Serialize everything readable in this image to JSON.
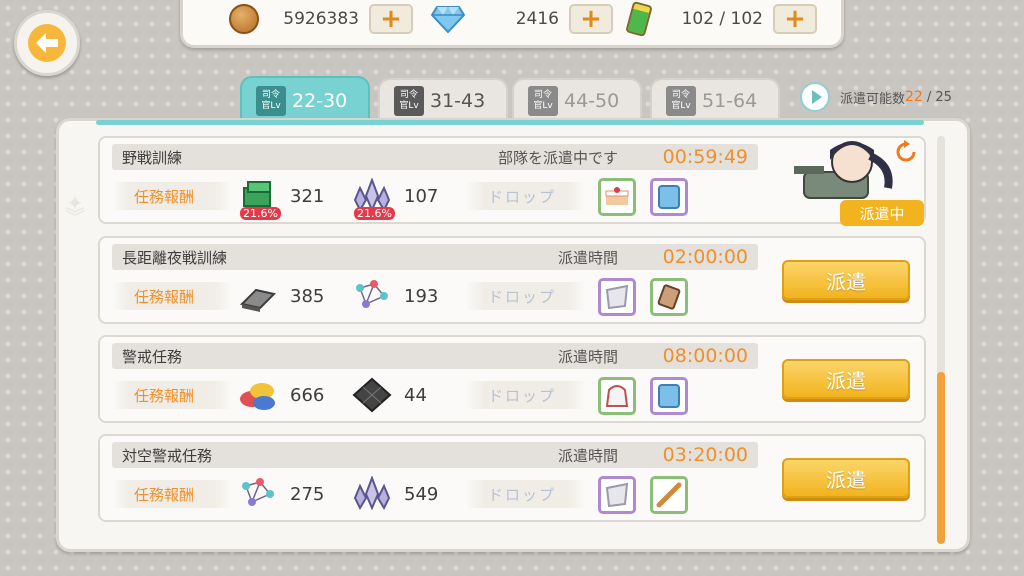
{
  "resources": {
    "coins": "5926383",
    "gems": "2416",
    "fuel": "102 / 102"
  },
  "tabs": [
    {
      "lv_top": "司令",
      "lv_bottom": "官Lv",
      "range": "22-30",
      "state": "active"
    },
    {
      "lv_top": "司令",
      "lv_bottom": "官Lv",
      "range": "31-43",
      "state": "normal"
    },
    {
      "lv_top": "司令",
      "lv_bottom": "官Lv",
      "range": "44-50",
      "state": "disabled"
    },
    {
      "lv_top": "司令",
      "lv_bottom": "官Lv",
      "range": "51-64",
      "state": "disabled"
    }
  ],
  "dispatch_count": {
    "label": "派遣可能数",
    "current": "22",
    "total": "/ 25"
  },
  "missions": [
    {
      "name": "野戦訓練",
      "status": "部隊を派遣中です",
      "time": "00:59:49",
      "reward_label": "任務報酬",
      "rewards": [
        {
          "icon": "steel-icon",
          "value": "321",
          "bonus": "21.6%"
        },
        {
          "icon": "crystal-icon",
          "value": "107",
          "bonus": "21.6%"
        }
      ],
      "drop_label": "ドロップ",
      "drops": [
        "cake-icon",
        "blanket-icon"
      ],
      "action": "派遣中"
    },
    {
      "name": "長距離夜戦訓練",
      "status": "派遣時間",
      "time": "02:00:00",
      "reward_label": "任務報酬",
      "rewards": [
        {
          "icon": "iron-plate-icon",
          "value": "385"
        },
        {
          "icon": "molecule-icon",
          "value": "193"
        }
      ],
      "drop_label": "ドロップ",
      "drops": [
        "cloth-icon",
        "ticket-icon"
      ],
      "action": "派遣"
    },
    {
      "name": "警戒任務",
      "status": "派遣時間",
      "time": "08:00:00",
      "reward_label": "任務報酬",
      "rewards": [
        {
          "icon": "paint-icon",
          "value": "666"
        },
        {
          "icon": "carbon-icon",
          "value": "44"
        }
      ],
      "drop_label": "ドロップ",
      "drops": [
        "bag-icon",
        "blanket-icon"
      ],
      "action": "派遣"
    },
    {
      "name": "対空警戒任務",
      "status": "派遣時間",
      "time": "03:20:00",
      "reward_label": "任務報酬",
      "rewards": [
        {
          "icon": "molecule-icon",
          "value": "275"
        },
        {
          "icon": "crystal-icon",
          "value": "549"
        }
      ],
      "drop_label": "ドロップ",
      "drops": [
        "cloth-icon",
        "stick-icon"
      ],
      "action": "派遣"
    }
  ],
  "colors": {
    "accent_teal": "#78d2d1",
    "accent_orange": "#f0902a",
    "button_yellow": "#f2b31e"
  }
}
